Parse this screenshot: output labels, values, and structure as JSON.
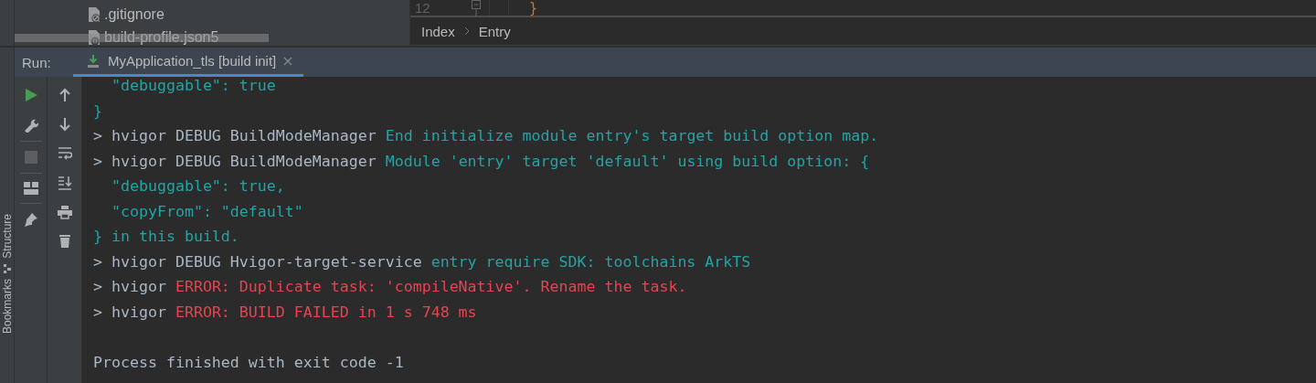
{
  "project_tree": {
    "items": [
      {
        "name": ".gitignore",
        "kind": "ignore"
      },
      {
        "name": "build-profile.json5",
        "kind": "json"
      }
    ]
  },
  "editor": {
    "line_number": "12",
    "code": "}",
    "breadcrumbs": [
      "Index",
      "Entry"
    ]
  },
  "run_panel": {
    "label": "Run:",
    "tabs": [
      {
        "title": "MyApplication_tls [build init]",
        "selected": true
      }
    ],
    "left_toolbar": [
      {
        "disabled": false
      },
      {
        "disabled": false
      },
      {
        "disabled": true
      },
      {
        "disabled": false
      },
      {
        "disabled": false
      }
    ],
    "console": {
      "lines": [
        {
          "segments": [
            {
              "text": "  \"debuggable\": true",
              "kind": "info"
            }
          ]
        },
        {
          "segments": [
            {
              "text": "}",
              "kind": "info"
            }
          ]
        },
        {
          "segments": [
            {
              "text": "> hvigor DEBUG BuildModeManager ",
              "kind": "plain"
            },
            {
              "text": "End initialize module entry's target build option map.",
              "kind": "info"
            }
          ]
        },
        {
          "segments": [
            {
              "text": "> hvigor DEBUG BuildModeManager ",
              "kind": "plain"
            },
            {
              "text": "Module 'entry' target 'default' using build option: {",
              "kind": "info"
            }
          ]
        },
        {
          "segments": [
            {
              "text": "  \"debuggable\": true,",
              "kind": "info"
            }
          ]
        },
        {
          "segments": [
            {
              "text": "  \"copyFrom\": \"default\"",
              "kind": "info"
            }
          ]
        },
        {
          "segments": [
            {
              "text": "} in this build.",
              "kind": "info"
            }
          ]
        },
        {
          "segments": [
            {
              "text": "> hvigor DEBUG Hvigor-target-service ",
              "kind": "plain"
            },
            {
              "text": "entry require SDK: toolchains ArkTS",
              "kind": "info"
            }
          ]
        },
        {
          "segments": [
            {
              "text": "> hvigor ",
              "kind": "plain"
            },
            {
              "text": "ERROR: Duplicate task: 'compileNative'. Rename the task.",
              "kind": "error"
            }
          ]
        },
        {
          "segments": [
            {
              "text": "> hvigor ",
              "kind": "plain"
            },
            {
              "text": "ERROR: BUILD FAILED in 1 s 748 ms",
              "kind": "error"
            }
          ]
        }
      ],
      "exit_message": "Process finished with exit code -1"
    }
  },
  "side_tabs": [
    "Structure",
    "Bookmarks"
  ]
}
